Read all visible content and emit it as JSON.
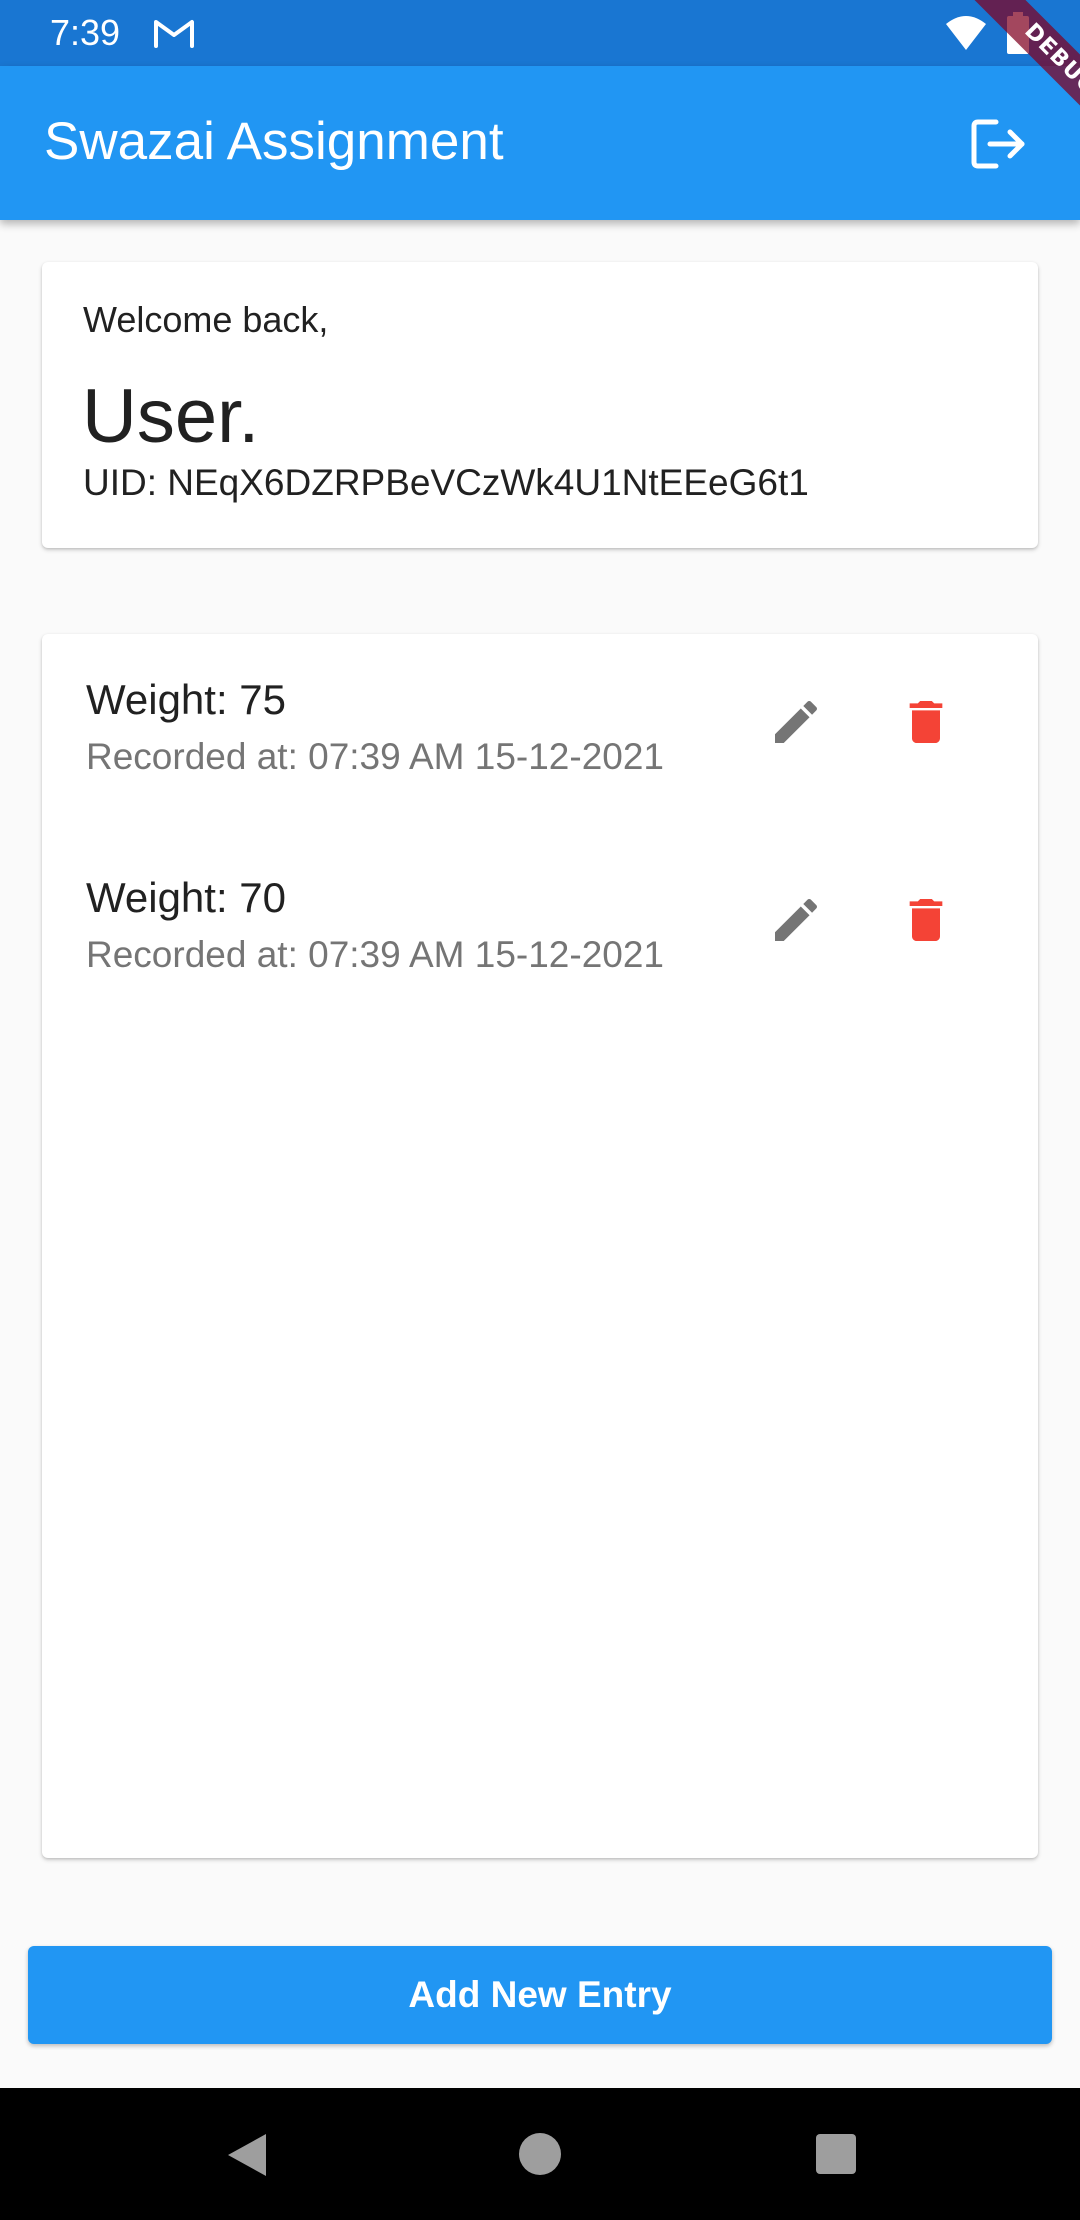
{
  "status_bar": {
    "time": "7:39",
    "icons": [
      "gmail-icon",
      "wifi-icon",
      "battery-icon"
    ]
  },
  "app_bar": {
    "title": "Swazai Assignment",
    "action_icon": "logout-icon"
  },
  "debug_banner": {
    "label": "DEBUG"
  },
  "welcome_card": {
    "greeting": "Welcome back,",
    "user_name": "User.",
    "uid": "UID: NEqX6DZRPBeVCzWk4U1NtEEeG6t1"
  },
  "entries": [
    {
      "weight": "Weight: 75",
      "recorded_at": "Recorded at: 07:39 AM 15-12-2021",
      "edit_icon": "edit-icon",
      "delete_icon": "delete-icon"
    },
    {
      "weight": "Weight: 70",
      "recorded_at": "Recorded at: 07:39 AM 15-12-2021",
      "edit_icon": "edit-icon",
      "delete_icon": "delete-icon"
    }
  ],
  "actions": {
    "add_entry_label": "Add New Entry"
  },
  "nav_bar": {
    "icons": [
      "back-icon",
      "home-icon",
      "recents-icon"
    ]
  },
  "colors": {
    "primary": "#2196f3",
    "status_bar": "#1976d2",
    "delete": "#f44336",
    "edit": "#757575",
    "background": "#fafafa"
  }
}
